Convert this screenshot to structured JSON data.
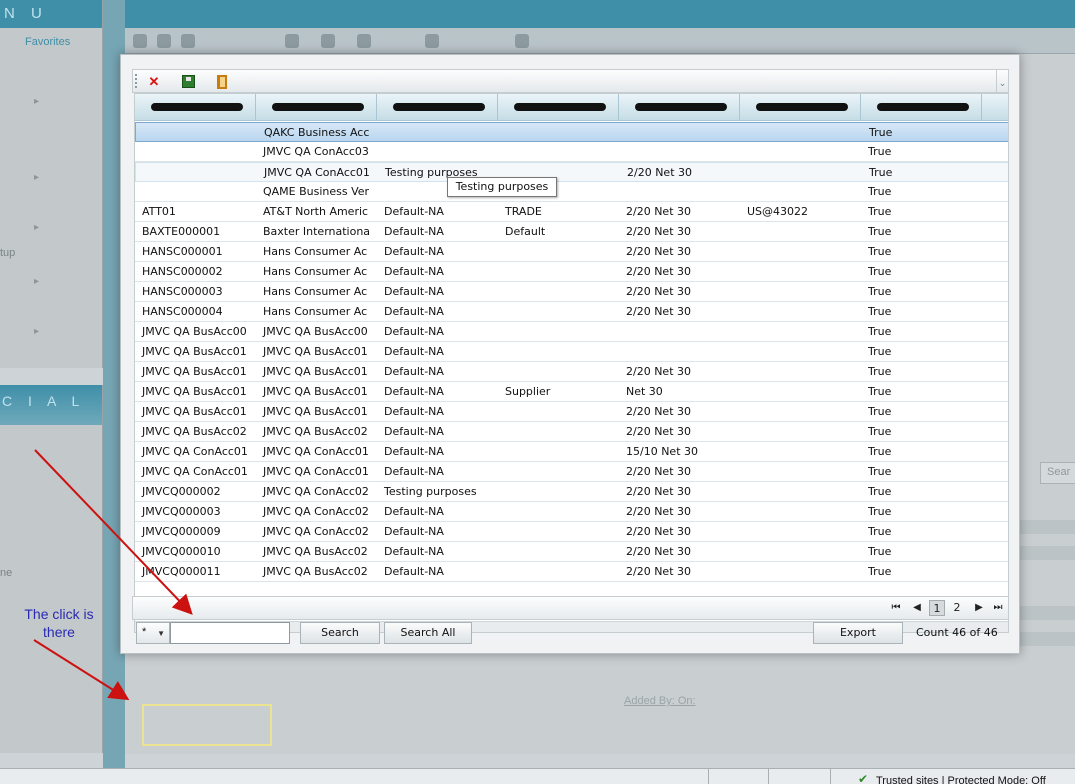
{
  "background": {
    "menu_title": "N U",
    "menu_favorites": "Favorites",
    "menu_item_setup": "tup",
    "panel2_title": "C I A L",
    "panel2_item": "ne",
    "added_by": "Added By: On:",
    "search_stub": "Sear"
  },
  "dialog": {
    "toolbar": {
      "delete_icon": "delete-red-x",
      "save_icon": "save-green",
      "exit_icon": "exit-door"
    },
    "columns": [
      "",
      "",
      "",
      "",
      "",
      "",
      ""
    ],
    "rows": [
      {
        "c1": "",
        "c2": "QAKC Business Acc",
        "c3": "",
        "c4": "",
        "c5": "",
        "c6": "",
        "c7": "True",
        "state": "selected"
      },
      {
        "c1": "",
        "c2": "JMVC QA ConAcc03",
        "c3": "",
        "c4": "",
        "c5": "",
        "c6": "",
        "c7": "True",
        "state": ""
      },
      {
        "c1": "",
        "c2": "JMVC QA ConAcc01",
        "c3": "Testing purposes",
        "c4": "",
        "c5": "2/20 Net 30",
        "c6": "",
        "c7": "True",
        "state": "hovered"
      },
      {
        "c1": "",
        "c2": "QAME Business Ver",
        "c3": "",
        "c4": "",
        "c5": "",
        "c6": "",
        "c7": "True",
        "state": ""
      },
      {
        "c1": "ATT01",
        "c2": "AT&T North Americ",
        "c3": "Default-NA",
        "c4": "TRADE",
        "c5": "2/20 Net 30",
        "c6": "US@43022",
        "c7": "True",
        "state": ""
      },
      {
        "c1": "BAXTE000001",
        "c2": "Baxter Internationa",
        "c3": "Default-NA",
        "c4": "Default",
        "c5": "2/20 Net 30",
        "c6": "",
        "c7": "True",
        "state": ""
      },
      {
        "c1": "HANSC000001",
        "c2": "Hans Consumer Ac",
        "c3": "Default-NA",
        "c4": "",
        "c5": "2/20 Net 30",
        "c6": "",
        "c7": "True",
        "state": ""
      },
      {
        "c1": "HANSC000002",
        "c2": "Hans Consumer Ac",
        "c3": "Default-NA",
        "c4": "",
        "c5": "2/20 Net 30",
        "c6": "",
        "c7": "True",
        "state": ""
      },
      {
        "c1": "HANSC000003",
        "c2": "Hans Consumer Ac",
        "c3": "Default-NA",
        "c4": "",
        "c5": "2/20 Net 30",
        "c6": "",
        "c7": "True",
        "state": ""
      },
      {
        "c1": "HANSC000004",
        "c2": "Hans Consumer Ac",
        "c3": "Default-NA",
        "c4": "",
        "c5": "2/20 Net 30",
        "c6": "",
        "c7": "True",
        "state": ""
      },
      {
        "c1": "JMVC QA BusAcc00",
        "c2": "JMVC QA BusAcc00",
        "c3": "Default-NA",
        "c4": "",
        "c5": "",
        "c6": "",
        "c7": "True",
        "state": ""
      },
      {
        "c1": "JMVC QA BusAcc01",
        "c2": "JMVC QA BusAcc01",
        "c3": "Default-NA",
        "c4": "",
        "c5": "",
        "c6": "",
        "c7": "True",
        "state": ""
      },
      {
        "c1": "JMVC QA BusAcc01",
        "c2": "JMVC QA BusAcc01",
        "c3": "Default-NA",
        "c4": "",
        "c5": "2/20 Net 30",
        "c6": "",
        "c7": "True",
        "state": ""
      },
      {
        "c1": "JMVC QA BusAcc01",
        "c2": "JMVC QA BusAcc01",
        "c3": "Default-NA",
        "c4": "Supplier",
        "c5": "Net 30",
        "c6": "",
        "c7": "True",
        "state": ""
      },
      {
        "c1": "JMVC QA BusAcc01",
        "c2": "JMVC QA BusAcc01",
        "c3": "Default-NA",
        "c4": "",
        "c5": "2/20 Net 30",
        "c6": "",
        "c7": "True",
        "state": ""
      },
      {
        "c1": "JMVC QA BusAcc02",
        "c2": "JMVC QA BusAcc02",
        "c3": "Default-NA",
        "c4": "",
        "c5": "2/20 Net 30",
        "c6": "",
        "c7": "True",
        "state": ""
      },
      {
        "c1": "JMVC QA ConAcc01",
        "c2": "JMVC QA ConAcc01",
        "c3": "Default-NA",
        "c4": "",
        "c5": "15/10 Net 30",
        "c6": "",
        "c7": "True",
        "state": ""
      },
      {
        "c1": "JMVC QA ConAcc01",
        "c2": "JMVC QA ConAcc01",
        "c3": "Default-NA",
        "c4": "",
        "c5": "2/20 Net 30",
        "c6": "",
        "c7": "True",
        "state": ""
      },
      {
        "c1": "JMVCQ000002",
        "c2": "JMVC QA ConAcc02",
        "c3": "Testing purposes",
        "c4": "",
        "c5": "2/20 Net 30",
        "c6": "",
        "c7": "True",
        "state": ""
      },
      {
        "c1": "JMVCQ000003",
        "c2": "JMVC QA ConAcc02",
        "c3": "Default-NA",
        "c4": "",
        "c5": "2/20 Net 30",
        "c6": "",
        "c7": "True",
        "state": ""
      },
      {
        "c1": "JMVCQ000009",
        "c2": "JMVC QA ConAcc02",
        "c3": "Default-NA",
        "c4": "",
        "c5": "2/20 Net 30",
        "c6": "",
        "c7": "True",
        "state": ""
      },
      {
        "c1": "JMVCQ000010",
        "c2": "JMVC QA BusAcc02",
        "c3": "Default-NA",
        "c4": "",
        "c5": "2/20 Net 30",
        "c6": "",
        "c7": "True",
        "state": ""
      },
      {
        "c1": "JMVCQ000011",
        "c2": "JMVC QA BusAcc02",
        "c3": "Default-NA",
        "c4": "",
        "c5": "2/20 Net 30",
        "c6": "",
        "c7": "True",
        "state": ""
      }
    ],
    "tooltip": "Testing purposes",
    "pager": {
      "page1": "1",
      "page2": "2",
      "current_page": 1
    },
    "search": {
      "operator": "*",
      "input_value": "",
      "search_label": "Search",
      "search_all_label": "Search All",
      "export_label": "Export",
      "count_text": "Count 46 of 46"
    }
  },
  "annotation": {
    "note": "The click is there",
    "color": "#2a2ab0",
    "arrow_color": "#cc1111",
    "highlight_color": "#ebe38f"
  },
  "statusbar": {
    "zone_text": "Trusted sites | Protected Mode: Off"
  }
}
